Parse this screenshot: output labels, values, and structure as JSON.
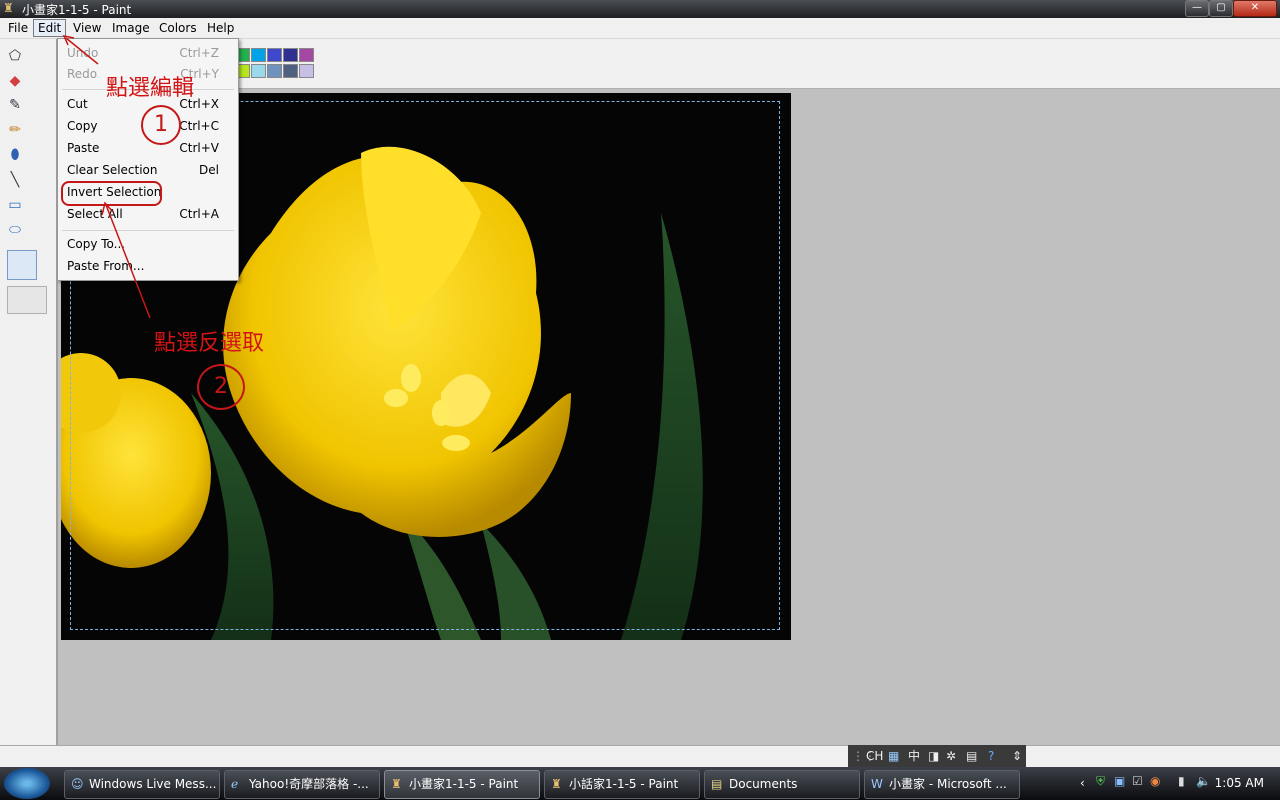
{
  "window": {
    "title": "小畫家1-1-5 - Paint",
    "controls": {
      "minimize": "—",
      "maximize": "▢",
      "close": "✕"
    }
  },
  "menubar": [
    "File",
    "Edit",
    "View",
    "Image",
    "Colors",
    "Help"
  ],
  "edit_menu": [
    {
      "label": "Undo",
      "shortcut": "Ctrl+Z",
      "disabled": true
    },
    {
      "label": "Redo",
      "shortcut": "Ctrl+Y",
      "disabled": true
    },
    {
      "label": "Cut",
      "shortcut": "Ctrl+X"
    },
    {
      "label": "Copy",
      "shortcut": "Ctrl+C"
    },
    {
      "label": "Paste",
      "shortcut": "Ctrl+V"
    },
    {
      "label": "Clear Selection",
      "shortcut": "Del"
    },
    {
      "label": "Invert Selection",
      "shortcut": ""
    },
    {
      "label": "Select All",
      "shortcut": "Ctrl+A"
    },
    {
      "label": "Copy To...",
      "shortcut": ""
    },
    {
      "label": "Paste From...",
      "shortcut": ""
    }
  ],
  "annotations": {
    "step1_text": "點選編輯",
    "step1_num": "1",
    "step2_text": "點選反選取",
    "step2_num": "2",
    "color": "#d21414"
  },
  "tools": [
    {
      "name": "free-select-icon",
      "glyph": "⬠"
    },
    {
      "name": "eraser-icon",
      "glyph": "◆"
    },
    {
      "name": "color-picker-icon",
      "glyph": "✎"
    },
    {
      "name": "pencil-icon",
      "glyph": "✏"
    },
    {
      "name": "fill-icon",
      "glyph": "⬮"
    },
    {
      "name": "line-icon",
      "glyph": "╲"
    },
    {
      "name": "rectangle-icon",
      "glyph": "▭"
    },
    {
      "name": "ellipse-icon",
      "glyph": "⬭"
    }
  ],
  "palette": {
    "row1": [
      "#22b14c",
      "#00a2e8",
      "#3f48cc",
      "#303090",
      "#a349a4"
    ],
    "row2": [
      "#b5e61d",
      "#99d9ea",
      "#7092be",
      "#506080",
      "#c8bfe7"
    ]
  },
  "language_bar": {
    "lang": "CH",
    "ime": "中"
  },
  "taskbar": {
    "items": [
      {
        "label": "Windows Live Mess...",
        "icon": "messenger-icon"
      },
      {
        "label": "Yahoo!奇摩部落格 -...",
        "icon": "ie-icon"
      },
      {
        "label": "小畫家1-1-5 - Paint",
        "icon": "paint-icon",
        "active": true
      },
      {
        "label": "小話家1-1-5 - Paint",
        "icon": "paint-icon"
      },
      {
        "label": "Documents",
        "icon": "folder-icon"
      },
      {
        "label": "小畫家 - Microsoft ...",
        "icon": "word-icon"
      }
    ],
    "clock": "1:05 AM"
  }
}
